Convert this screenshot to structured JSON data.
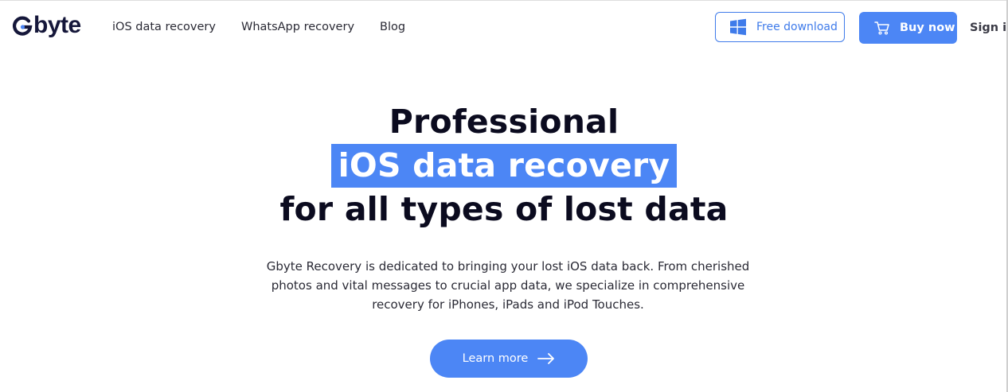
{
  "logo": {
    "text": "byte"
  },
  "nav": {
    "items": [
      {
        "label": "iOS data recovery"
      },
      {
        "label": "WhatsApp recovery"
      },
      {
        "label": "Blog"
      }
    ]
  },
  "header": {
    "free_download_label": "Free download",
    "buy_now_label": "Buy now",
    "sign_in_label": "Sign in"
  },
  "hero": {
    "line1": "Professional",
    "highlight": "iOS data recovery",
    "line3": "for all types of lost data",
    "description": "Gbyte Recovery is dedicated to bringing your lost iOS data back. From cherished photos and vital messages to crucial app data, we specialize in comprehensive recovery for iPhones, iPads and iPod Touches.",
    "cta_label": "Learn more"
  },
  "colors": {
    "accent": "#4c86f5",
    "text": "#0b0b1f",
    "logo": "#15173a"
  },
  "icons": {
    "free_download": "windows-icon",
    "buy_now": "cart-icon",
    "cta": "arrow-right-icon",
    "logo": "g-logo-icon"
  }
}
